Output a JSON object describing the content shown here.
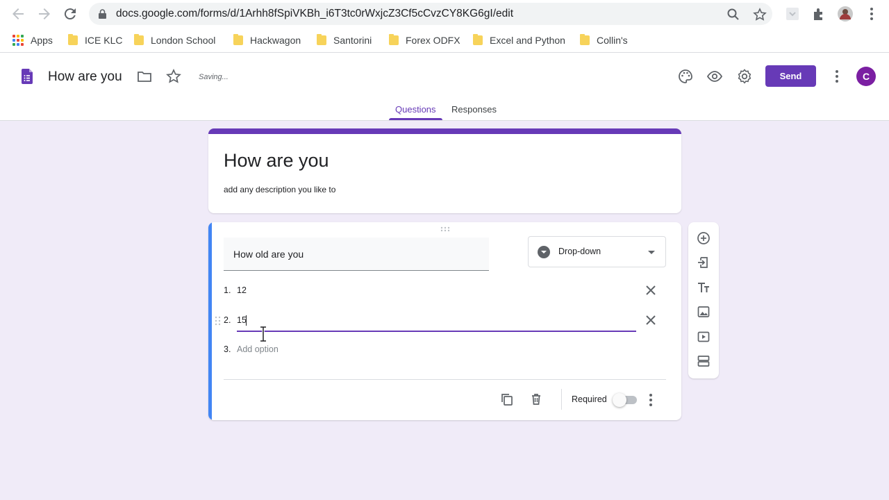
{
  "browser": {
    "url": "docs.google.com/forms/d/1Arhh8fSpiVKBh_i6T3tc0rWxjcZ3Cf5cCvzCY8KG6gI/edit",
    "bookmarks": [
      {
        "label": "Apps",
        "icon": "apps-grid-icon"
      },
      {
        "label": "ICE KLC",
        "icon": "folder-icon"
      },
      {
        "label": "London School",
        "icon": "folder-icon"
      },
      {
        "label": "Hackwagon",
        "icon": "folder-icon"
      },
      {
        "label": "Santorini",
        "icon": "folder-icon"
      },
      {
        "label": "Forex ODFX",
        "icon": "folder-icon"
      },
      {
        "label": "Excel and Python",
        "icon": "folder-icon"
      },
      {
        "label": "Collin's",
        "icon": "folder-icon"
      }
    ]
  },
  "header": {
    "doc_title": "How are you",
    "status": "Saving...",
    "send_label": "Send",
    "avatar_initial": "C",
    "tabs": [
      {
        "label": "Questions",
        "active": true
      },
      {
        "label": "Responses",
        "active": false
      }
    ]
  },
  "form": {
    "title": "How are you",
    "description": "add any description you like to"
  },
  "question": {
    "title": "How old are you",
    "type_label": "Drop-down",
    "options": [
      {
        "number": "1.",
        "value": "12"
      },
      {
        "number": "2.",
        "value": "15"
      }
    ],
    "add_option_number": "3.",
    "add_option_label": "Add option",
    "required_label": "Required",
    "required": false
  },
  "colors": {
    "brand": "#673ab7",
    "background": "#f0ebf8",
    "question_accent": "#4285f4"
  }
}
